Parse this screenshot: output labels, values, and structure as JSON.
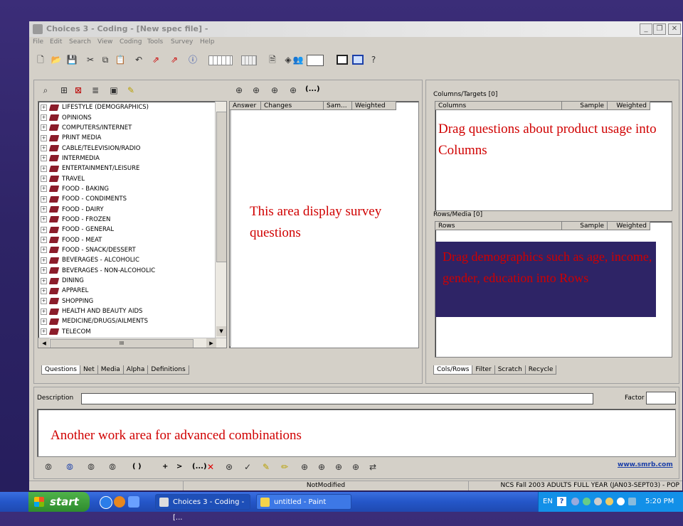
{
  "window": {
    "title": "Choices 3 - Coding - [New spec file] -",
    "controls": [
      "_",
      "❐",
      "✕"
    ]
  },
  "menubar": [
    "File",
    "Edit",
    "Search",
    "View",
    "Coding",
    "Tools",
    "Survey",
    "Help"
  ],
  "left_panel": {
    "tree_items": [
      "LIFESTYLE (DEMOGRAPHICS)",
      "OPINIONS",
      "COMPUTERS/INTERNET",
      "PRINT MEDIA",
      "CABLE/TELEVISION/RADIO",
      "INTERMEDIA",
      "ENTERTAINMENT/LEISURE",
      "TRAVEL",
      "FOOD - BAKING",
      "FOOD - CONDIMENTS",
      "FOOD - DAIRY",
      "FOOD - FROZEN",
      "FOOD - GENERAL",
      "FOOD - MEAT",
      "FOOD - SNACK/DESSERT",
      "BEVERAGES - ALCOHOLIC",
      "BEVERAGES - NON-ALCOHOLIC",
      "DINING",
      "APPAREL",
      "SHOPPING",
      "HEALTH AND BEAUTY AIDS",
      "MEDICINE/DRUGS/AILMENTS",
      "TELECOM"
    ],
    "tabs": [
      "Questions",
      "Net",
      "Media",
      "Alpha",
      "Definitions"
    ],
    "scroll_mark": "III"
  },
  "answers_panel": {
    "columns": [
      "Answer",
      "Changes",
      "Sam...",
      "Weighted"
    ],
    "note": "This area display survey questions",
    "toolbar_paren": "(...)"
  },
  "right_panel": {
    "columns_label": "Columns/Targets [0]",
    "columns_header": [
      "Columns",
      "Sample",
      "Weighted"
    ],
    "columns_note": "Drag questions about product usage into Columns",
    "rows_label": "Rows/Media [0]",
    "rows_header": [
      "Rows",
      "Sample",
      "Weighted"
    ],
    "rows_note": "Drag demographics such as age, income, gender, education into Rows",
    "tabs": [
      "Cols/Rows",
      "Filter",
      "Scratch",
      "Recycle"
    ]
  },
  "bottom": {
    "description_label": "Description",
    "description_value": "",
    "factor_label": "Factor",
    "factor_value": "",
    "work_note": "Another work area for advanced combinations",
    "ops": [
      "( )",
      "+",
      ">",
      "(...)"
    ],
    "link": "www.smrb.com"
  },
  "statusbar": {
    "state": "NotModified",
    "survey": "NCS Fall 2003 ADULTS FULL YEAR (JAN03-SEPT03) - POP"
  },
  "taskbar": {
    "start": "start",
    "items": [
      "Choices 3 - Coding - [...",
      "untitled - Paint"
    ],
    "lang": "EN",
    "time": "5:20 PM"
  },
  "colors": {
    "note_red": "#d00000",
    "rows_note_bg": "#2e2466",
    "book": "#8b1c2a"
  }
}
